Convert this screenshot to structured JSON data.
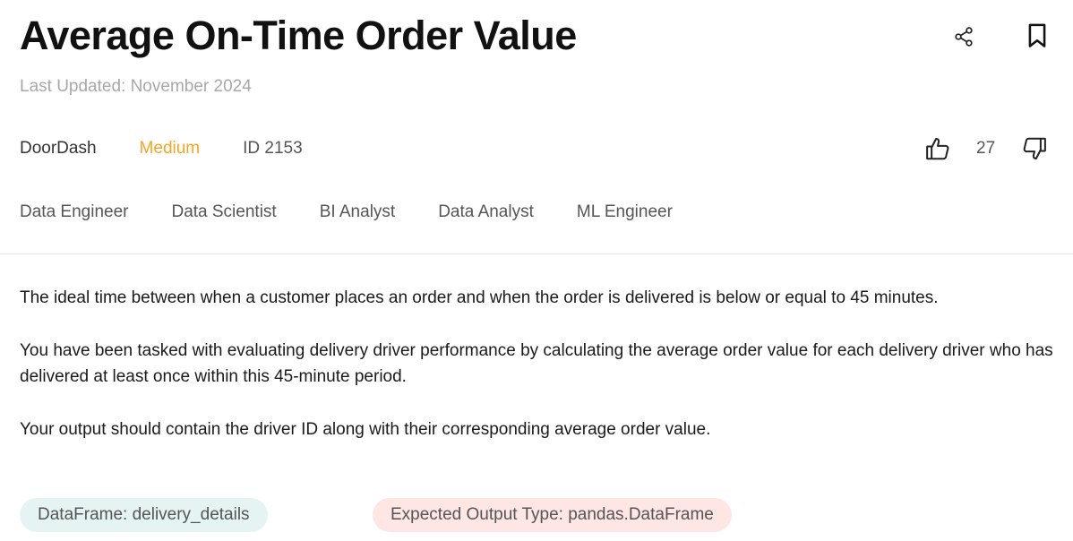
{
  "header": {
    "title": "Average On-Time Order Value",
    "last_updated": "Last Updated: November 2024"
  },
  "meta": {
    "company": "DoorDash",
    "difficulty": "Medium",
    "question_id": "ID 2153",
    "vote_count": "27"
  },
  "roles": [
    "Data Engineer",
    "Data Scientist",
    "BI Analyst",
    "Data Analyst",
    "ML Engineer"
  ],
  "description": [
    "The ideal time between when a customer places an order and when the order is delivered is below or equal to 45 minutes.",
    "You have been tasked with evaluating delivery driver performance by calculating the average order value for each delivery driver who has delivered at least once within this 45-minute period.",
    "Your output should contain the driver ID along with their corresponding average order value."
  ],
  "tags": {
    "dataframe": "DataFrame: delivery_details",
    "expected_output": "Expected Output Type: pandas.DataFrame"
  },
  "colors": {
    "difficulty_medium": "#f5a623",
    "dataframe_pill_bg": "#e5f4f2",
    "output_pill_bg": "#fde6e4"
  },
  "icons": {
    "share": "share-icon",
    "bookmark": "bookmark-icon",
    "upvote": "thumbs-up-icon",
    "downvote": "thumbs-down-icon"
  }
}
